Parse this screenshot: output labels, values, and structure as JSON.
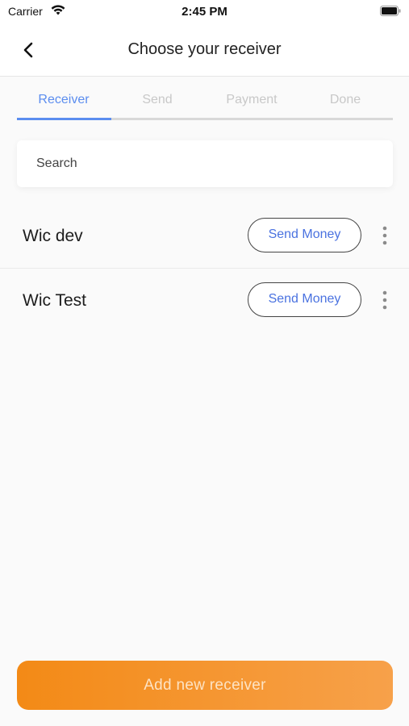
{
  "status_bar": {
    "carrier": "Carrier",
    "time": "2:45 PM",
    "icons": [
      "wifi-icon",
      "battery-icon"
    ]
  },
  "nav": {
    "title": "Choose your receiver",
    "back_icon": "chevron-left-icon"
  },
  "stepper": {
    "steps": [
      {
        "label": "Receiver",
        "active": true
      },
      {
        "label": "Send",
        "active": false
      },
      {
        "label": "Payment",
        "active": false
      },
      {
        "label": "Done",
        "active": false
      }
    ],
    "active_color": "#5b8def",
    "inactive_color": "#c8c8c8"
  },
  "search": {
    "placeholder": "Search"
  },
  "receivers": [
    {
      "name": "Wic dev",
      "action_label": "Send Money",
      "menu_icon": "more-vertical-icon"
    },
    {
      "name": "Wic Test",
      "action_label": "Send Money",
      "menu_icon": "more-vertical-icon"
    }
  ],
  "footer": {
    "add_label": "Add new receiver",
    "accent_start": "#f38a16",
    "accent_end": "#f7a14a"
  }
}
